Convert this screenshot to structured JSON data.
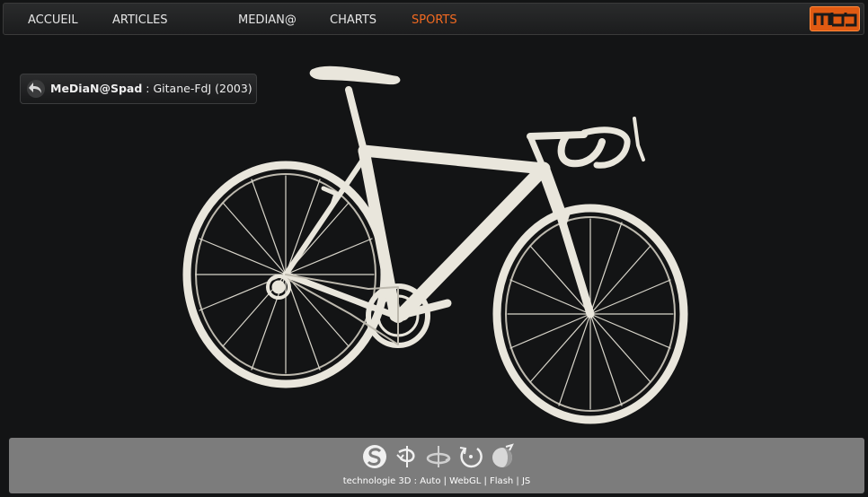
{
  "nav": {
    "items": [
      {
        "label": "ACCUEIL"
      },
      {
        "label": "ARTICLES"
      },
      {
        "label": "MEDIAN@"
      },
      {
        "label": "CHARTS"
      },
      {
        "label": "SPORTS"
      }
    ],
    "active_color": "#f26a21",
    "logo_text": "mdb"
  },
  "title_pill": {
    "author": "MeDiaN@Spad",
    "separator": " : ",
    "model": "Gitane-FdJ (2003)"
  },
  "viewer": {
    "subject": "bicycle-3d-model",
    "model_color": "#e9e6dc",
    "background": "#131415"
  },
  "controls": {
    "icons": [
      "spin-icon",
      "rotate-horizontal-icon",
      "rotate-axis-icon",
      "rotate-ccw-icon",
      "shading-icon"
    ],
    "tech_label": "technologie 3D : ",
    "options": [
      {
        "label": "Auto"
      },
      {
        "label": "WebGL"
      },
      {
        "label": "Flash"
      },
      {
        "label": "JS"
      }
    ],
    "divider": " | "
  }
}
